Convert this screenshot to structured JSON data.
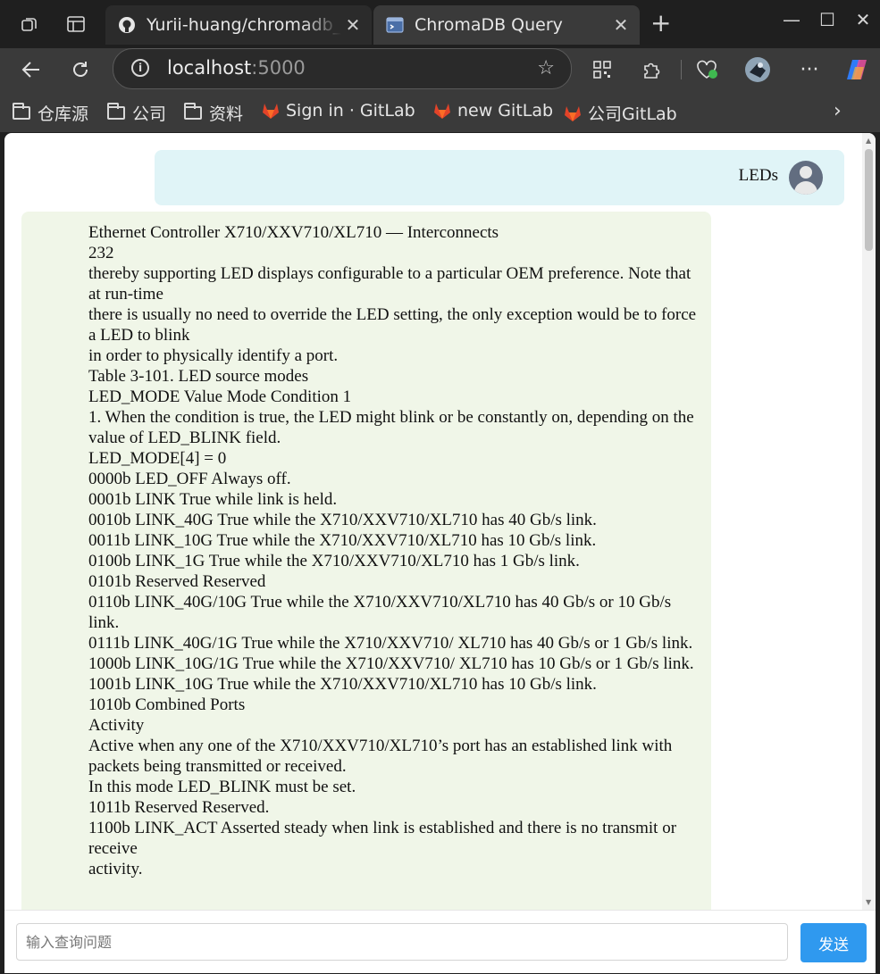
{
  "browser": {
    "tabs": [
      {
        "label": "Yurii-huang/chromadb_rag",
        "icon": "github-icon"
      },
      {
        "label": "ChromaDB Query",
        "icon": "terminal-icon"
      }
    ],
    "address": {
      "host": "localhost",
      "port": ":5000"
    },
    "bookmarks": [
      {
        "label": "仓库源",
        "icon": "folder-icon"
      },
      {
        "label": "公司",
        "icon": "folder-icon"
      },
      {
        "label": "资料",
        "icon": "folder-icon"
      },
      {
        "label": "Sign in · GitLab",
        "icon": "gitlab-icon"
      },
      {
        "label": "new GitLab",
        "icon": "gitlab-icon"
      },
      {
        "label": "公司GitLab",
        "icon": "gitlab-icon"
      }
    ]
  },
  "chat": {
    "user_message": "LEDs",
    "bot_lines": [
      "Ethernet Controller X710/XXV710/XL710 — Interconnects",
      "232",
      "thereby supporting LED displays configurable to a particular OEM preference. Note that at run-time",
      "there is usually no need to override the LED setting, the only exception would be to force a LED to blink",
      "in order to physically identify a port.",
      "Table 3-101. LED source modes",
      "LED_MODE Value Mode Condition 1",
      "1. When the condition is true, the LED might blink or be constantly on, depending on the value of LED_BLINK field.",
      "LED_MODE[4] = 0",
      "0000b LED_OFF Always off.",
      "0001b LINK True while link is held.",
      "0010b LINK_40G True while the X710/XXV710/XL710 has 40 Gb/s link.",
      "0011b LINK_10G True while the X710/XXV710/XL710 has 10 Gb/s link.",
      "0100b LINK_1G True while the X710/XXV710/XL710 has 1 Gb/s link.",
      "0101b Reserved Reserved",
      "0110b LINK_40G/10G True while the X710/XXV710/XL710 has 40 Gb/s or 10 Gb/s link.",
      "0111b LINK_40G/1G True while the X710/XXV710/ XL710 has 40 Gb/s or 1 Gb/s link.",
      "1000b LINK_10G/1G True while the X710/XXV710/ XL710 has 10 Gb/s or 1 Gb/s link.",
      "1001b LINK_10G True while the X710/XXV710/XL710 has 10 Gb/s link.",
      "1010b Combined Ports",
      "Activity",
      "Active when any one of the X710/XXV710/XL710’s port has an established link with packets being transmitted or received.",
      "In this mode LED_BLINK must be set.",
      "1011b Reserved Reserved.",
      "1100b LINK_ACT Asserted steady when link is established and there is no transmit or receive",
      "activity."
    ]
  },
  "composer": {
    "placeholder": "输入查询问题",
    "send_label": "发送"
  }
}
